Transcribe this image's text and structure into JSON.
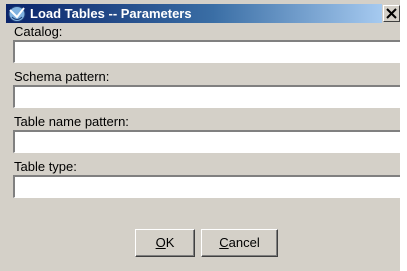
{
  "window": {
    "title": "Load Tables -- Parameters",
    "icon": "window-app-icon",
    "close_icon": "close-icon"
  },
  "fields": {
    "catalog": {
      "label": "Catalog:",
      "value": ""
    },
    "schema_pattern": {
      "label": "Schema pattern:",
      "value": ""
    },
    "table_name_pattern": {
      "label": "Table name pattern:",
      "value": ""
    },
    "table_type": {
      "label": "Table type:",
      "value": ""
    }
  },
  "buttons": {
    "ok": {
      "mnemonic": "O",
      "rest": "K"
    },
    "cancel": {
      "mnemonic": "C",
      "rest": "ancel"
    }
  },
  "colors": {
    "dialog_bg": "#d4d0c8",
    "titlebar_start": "#0a246a",
    "titlebar_end": "#a6caf0"
  }
}
